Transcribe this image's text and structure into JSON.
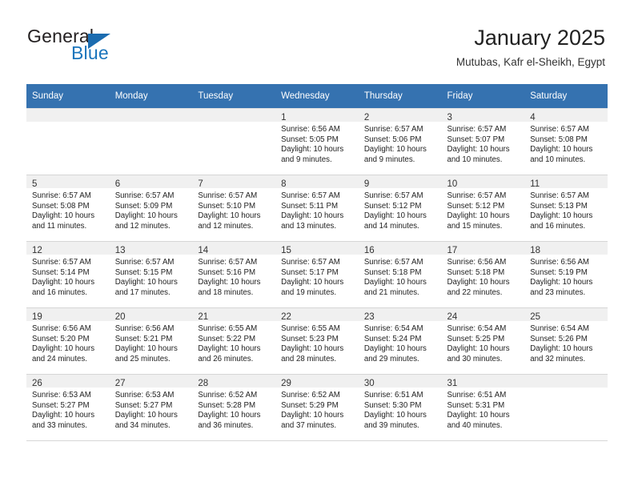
{
  "brand": {
    "name_part1": "General",
    "name_part2": "Blue",
    "triangle_color": "#1b6cb0",
    "blue": "#1b75bc"
  },
  "header": {
    "title": "January 2025",
    "location": "Mutubas, Kafr el-Sheikh, Egypt"
  },
  "theme": {
    "header_row_bg": "#3572b0",
    "daynum_strip_bg": "#f0f0f0",
    "text": "#222222"
  },
  "weekdays": [
    "Sunday",
    "Monday",
    "Tuesday",
    "Wednesday",
    "Thursday",
    "Friday",
    "Saturday"
  ],
  "weeks": [
    [
      {
        "day": "",
        "sunrise": "",
        "sunset": "",
        "daylight1": "",
        "daylight2": ""
      },
      {
        "day": "",
        "sunrise": "",
        "sunset": "",
        "daylight1": "",
        "daylight2": ""
      },
      {
        "day": "",
        "sunrise": "",
        "sunset": "",
        "daylight1": "",
        "daylight2": ""
      },
      {
        "day": "1",
        "sunrise": "Sunrise: 6:56 AM",
        "sunset": "Sunset: 5:05 PM",
        "daylight1": "Daylight: 10 hours",
        "daylight2": "and 9 minutes."
      },
      {
        "day": "2",
        "sunrise": "Sunrise: 6:57 AM",
        "sunset": "Sunset: 5:06 PM",
        "daylight1": "Daylight: 10 hours",
        "daylight2": "and 9 minutes."
      },
      {
        "day": "3",
        "sunrise": "Sunrise: 6:57 AM",
        "sunset": "Sunset: 5:07 PM",
        "daylight1": "Daylight: 10 hours",
        "daylight2": "and 10 minutes."
      },
      {
        "day": "4",
        "sunrise": "Sunrise: 6:57 AM",
        "sunset": "Sunset: 5:08 PM",
        "daylight1": "Daylight: 10 hours",
        "daylight2": "and 10 minutes."
      }
    ],
    [
      {
        "day": "5",
        "sunrise": "Sunrise: 6:57 AM",
        "sunset": "Sunset: 5:08 PM",
        "daylight1": "Daylight: 10 hours",
        "daylight2": "and 11 minutes."
      },
      {
        "day": "6",
        "sunrise": "Sunrise: 6:57 AM",
        "sunset": "Sunset: 5:09 PM",
        "daylight1": "Daylight: 10 hours",
        "daylight2": "and 12 minutes."
      },
      {
        "day": "7",
        "sunrise": "Sunrise: 6:57 AM",
        "sunset": "Sunset: 5:10 PM",
        "daylight1": "Daylight: 10 hours",
        "daylight2": "and 12 minutes."
      },
      {
        "day": "8",
        "sunrise": "Sunrise: 6:57 AM",
        "sunset": "Sunset: 5:11 PM",
        "daylight1": "Daylight: 10 hours",
        "daylight2": "and 13 minutes."
      },
      {
        "day": "9",
        "sunrise": "Sunrise: 6:57 AM",
        "sunset": "Sunset: 5:12 PM",
        "daylight1": "Daylight: 10 hours",
        "daylight2": "and 14 minutes."
      },
      {
        "day": "10",
        "sunrise": "Sunrise: 6:57 AM",
        "sunset": "Sunset: 5:12 PM",
        "daylight1": "Daylight: 10 hours",
        "daylight2": "and 15 minutes."
      },
      {
        "day": "11",
        "sunrise": "Sunrise: 6:57 AM",
        "sunset": "Sunset: 5:13 PM",
        "daylight1": "Daylight: 10 hours",
        "daylight2": "and 16 minutes."
      }
    ],
    [
      {
        "day": "12",
        "sunrise": "Sunrise: 6:57 AM",
        "sunset": "Sunset: 5:14 PM",
        "daylight1": "Daylight: 10 hours",
        "daylight2": "and 16 minutes."
      },
      {
        "day": "13",
        "sunrise": "Sunrise: 6:57 AM",
        "sunset": "Sunset: 5:15 PM",
        "daylight1": "Daylight: 10 hours",
        "daylight2": "and 17 minutes."
      },
      {
        "day": "14",
        "sunrise": "Sunrise: 6:57 AM",
        "sunset": "Sunset: 5:16 PM",
        "daylight1": "Daylight: 10 hours",
        "daylight2": "and 18 minutes."
      },
      {
        "day": "15",
        "sunrise": "Sunrise: 6:57 AM",
        "sunset": "Sunset: 5:17 PM",
        "daylight1": "Daylight: 10 hours",
        "daylight2": "and 19 minutes."
      },
      {
        "day": "16",
        "sunrise": "Sunrise: 6:57 AM",
        "sunset": "Sunset: 5:18 PM",
        "daylight1": "Daylight: 10 hours",
        "daylight2": "and 21 minutes."
      },
      {
        "day": "17",
        "sunrise": "Sunrise: 6:56 AM",
        "sunset": "Sunset: 5:18 PM",
        "daylight1": "Daylight: 10 hours",
        "daylight2": "and 22 minutes."
      },
      {
        "day": "18",
        "sunrise": "Sunrise: 6:56 AM",
        "sunset": "Sunset: 5:19 PM",
        "daylight1": "Daylight: 10 hours",
        "daylight2": "and 23 minutes."
      }
    ],
    [
      {
        "day": "19",
        "sunrise": "Sunrise: 6:56 AM",
        "sunset": "Sunset: 5:20 PM",
        "daylight1": "Daylight: 10 hours",
        "daylight2": "and 24 minutes."
      },
      {
        "day": "20",
        "sunrise": "Sunrise: 6:56 AM",
        "sunset": "Sunset: 5:21 PM",
        "daylight1": "Daylight: 10 hours",
        "daylight2": "and 25 minutes."
      },
      {
        "day": "21",
        "sunrise": "Sunrise: 6:55 AM",
        "sunset": "Sunset: 5:22 PM",
        "daylight1": "Daylight: 10 hours",
        "daylight2": "and 26 minutes."
      },
      {
        "day": "22",
        "sunrise": "Sunrise: 6:55 AM",
        "sunset": "Sunset: 5:23 PM",
        "daylight1": "Daylight: 10 hours",
        "daylight2": "and 28 minutes."
      },
      {
        "day": "23",
        "sunrise": "Sunrise: 6:54 AM",
        "sunset": "Sunset: 5:24 PM",
        "daylight1": "Daylight: 10 hours",
        "daylight2": "and 29 minutes."
      },
      {
        "day": "24",
        "sunrise": "Sunrise: 6:54 AM",
        "sunset": "Sunset: 5:25 PM",
        "daylight1": "Daylight: 10 hours",
        "daylight2": "and 30 minutes."
      },
      {
        "day": "25",
        "sunrise": "Sunrise: 6:54 AM",
        "sunset": "Sunset: 5:26 PM",
        "daylight1": "Daylight: 10 hours",
        "daylight2": "and 32 minutes."
      }
    ],
    [
      {
        "day": "26",
        "sunrise": "Sunrise: 6:53 AM",
        "sunset": "Sunset: 5:27 PM",
        "daylight1": "Daylight: 10 hours",
        "daylight2": "and 33 minutes."
      },
      {
        "day": "27",
        "sunrise": "Sunrise: 6:53 AM",
        "sunset": "Sunset: 5:27 PM",
        "daylight1": "Daylight: 10 hours",
        "daylight2": "and 34 minutes."
      },
      {
        "day": "28",
        "sunrise": "Sunrise: 6:52 AM",
        "sunset": "Sunset: 5:28 PM",
        "daylight1": "Daylight: 10 hours",
        "daylight2": "and 36 minutes."
      },
      {
        "day": "29",
        "sunrise": "Sunrise: 6:52 AM",
        "sunset": "Sunset: 5:29 PM",
        "daylight1": "Daylight: 10 hours",
        "daylight2": "and 37 minutes."
      },
      {
        "day": "30",
        "sunrise": "Sunrise: 6:51 AM",
        "sunset": "Sunset: 5:30 PM",
        "daylight1": "Daylight: 10 hours",
        "daylight2": "and 39 minutes."
      },
      {
        "day": "31",
        "sunrise": "Sunrise: 6:51 AM",
        "sunset": "Sunset: 5:31 PM",
        "daylight1": "Daylight: 10 hours",
        "daylight2": "and 40 minutes."
      },
      {
        "day": "",
        "sunrise": "",
        "sunset": "",
        "daylight1": "",
        "daylight2": ""
      }
    ]
  ]
}
